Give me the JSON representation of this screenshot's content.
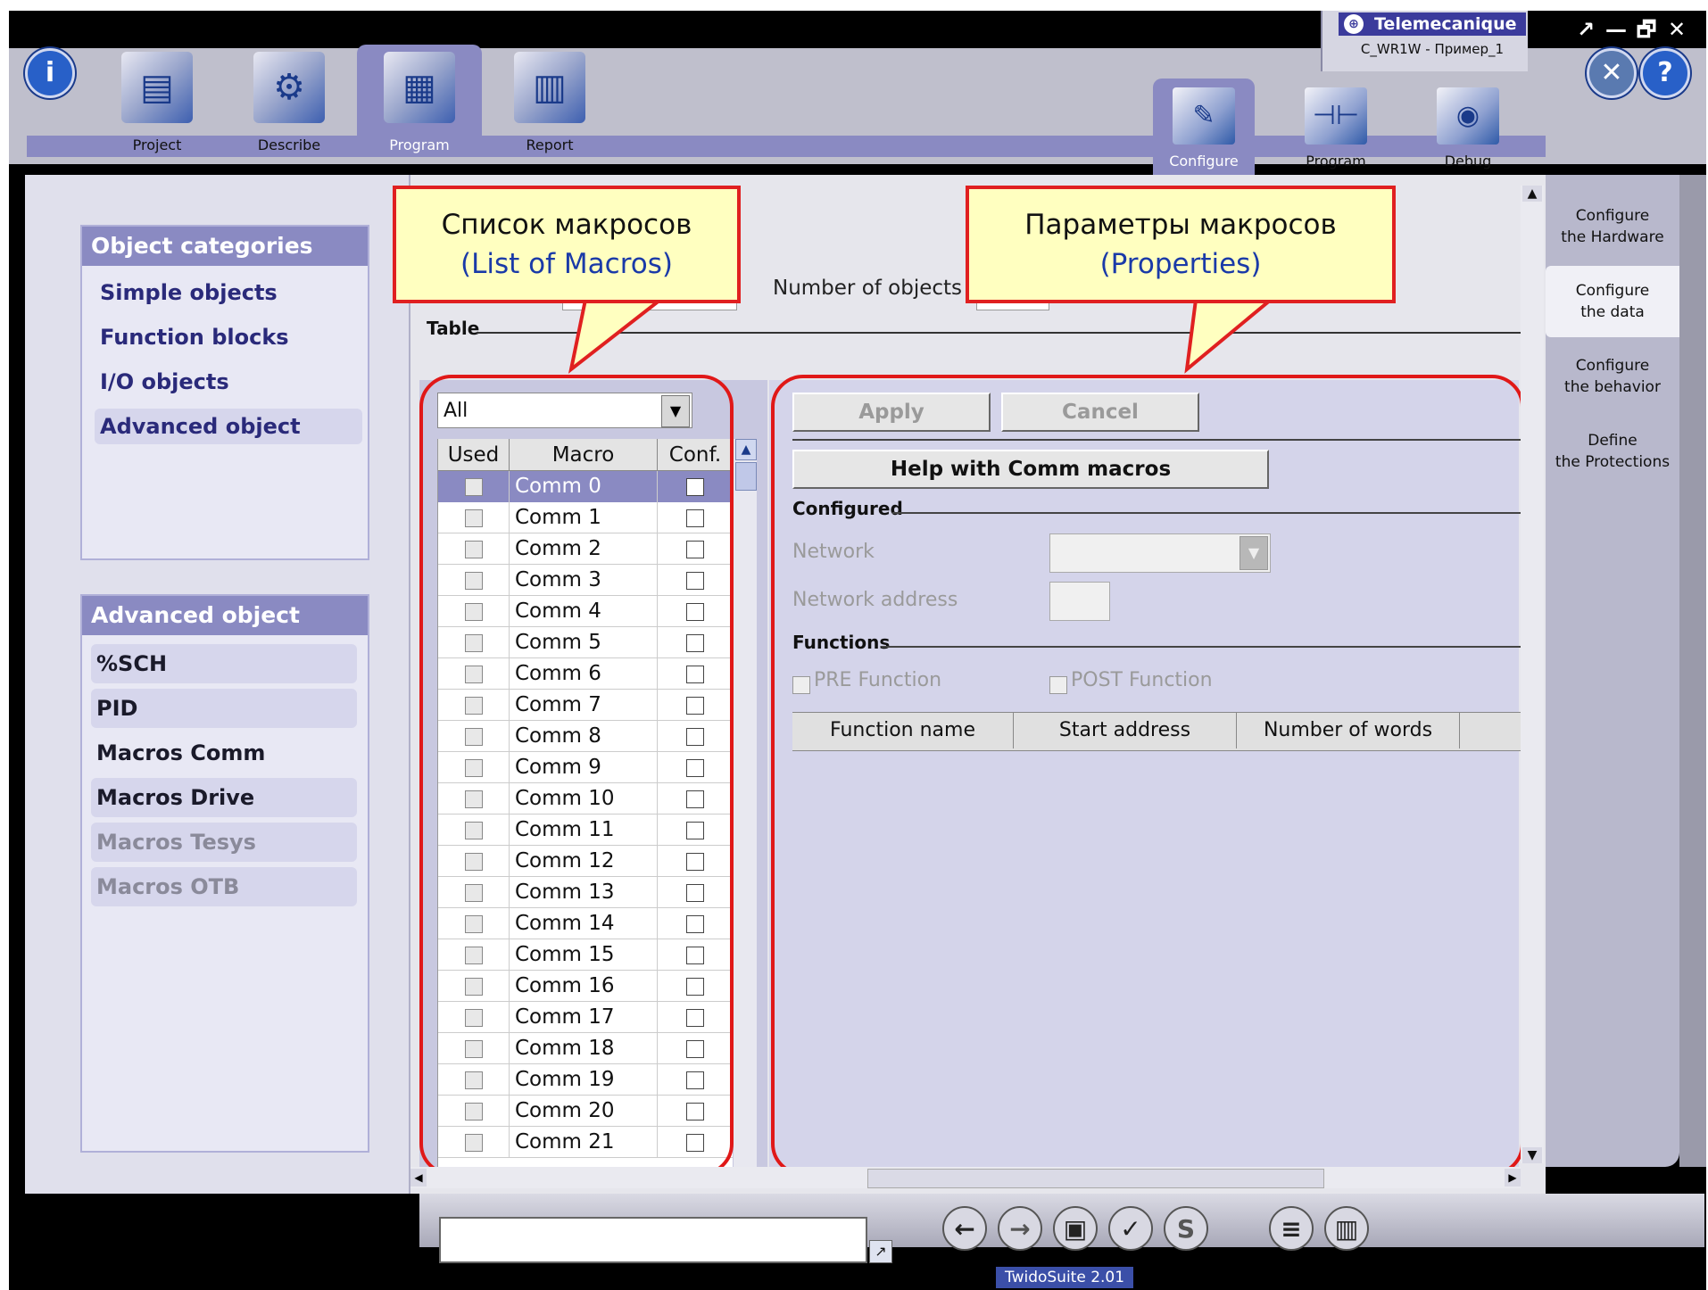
{
  "brand": {
    "name": "Telemecanique",
    "project": "C_WR1W - Пример_1"
  },
  "window_controls": [
    "↗",
    "—",
    "🗗",
    "✕"
  ],
  "top_tabs": [
    {
      "label": "Project",
      "icon": "project-folder-icon",
      "active": false
    },
    {
      "label": "Describe",
      "icon": "describe-folder-icon",
      "active": false
    },
    {
      "label": "Program",
      "icon": "program-folder-icon",
      "active": true
    },
    {
      "label": "Report",
      "icon": "report-folder-icon",
      "active": false
    }
  ],
  "sub_tabs": [
    {
      "label": "Configure",
      "icon": "configure-icon",
      "active": true
    },
    {
      "label": "Program",
      "icon": "program-ladder-icon",
      "active": false
    },
    {
      "label": "Debug",
      "icon": "debug-eye-icon",
      "active": false
    }
  ],
  "left": {
    "categories_title": "Object categories",
    "categories": [
      "Simple objects",
      "Function blocks",
      "I/O objects",
      "Advanced object"
    ],
    "selected_category": "Advanced object",
    "advanced_title": "Advanced object",
    "advanced_items": [
      {
        "label": "%SCH",
        "enabled": true
      },
      {
        "label": "PID",
        "enabled": true
      },
      {
        "label": "Macros Comm",
        "enabled": true
      },
      {
        "label": "Macros Drive",
        "enabled": true
      },
      {
        "label": "Macros Tesys",
        "enabled": false
      },
      {
        "label": "Macros OTB",
        "enabled": false
      }
    ]
  },
  "content": {
    "number_of_objects_label": "Number of objects",
    "table_label": "Table",
    "filter_value": "All",
    "columns": [
      "Used",
      "Macro",
      "Conf."
    ],
    "macros": [
      "Comm 0",
      "Comm 1",
      "Comm 2",
      "Comm 3",
      "Comm 4",
      "Comm 5",
      "Comm 6",
      "Comm 7",
      "Comm 8",
      "Comm 9",
      "Comm 10",
      "Comm 11",
      "Comm 12",
      "Comm 13",
      "Comm 14",
      "Comm 15",
      "Comm 16",
      "Comm 17",
      "Comm 18",
      "Comm 19",
      "Comm 20",
      "Comm 21"
    ],
    "selected_macro": "Comm 0"
  },
  "props": {
    "apply": "Apply",
    "cancel": "Cancel",
    "help": "Help with Comm macros",
    "configured": "Configured",
    "network": "Network",
    "network_address": "Network address",
    "functions": "Functions",
    "pre_function": "PRE Function",
    "post_function": "POST Function",
    "func_columns": [
      "Function name",
      "Start address",
      "Number of words"
    ]
  },
  "callouts": {
    "list": {
      "ru": "Список макросов",
      "en": "(List of Macros)"
    },
    "props": {
      "ru": "Параметры макросов",
      "en": "(Properties)"
    }
  },
  "right_nav": [
    {
      "line1": "Configure",
      "line2": "the Hardware",
      "active": false
    },
    {
      "line1": "Configure",
      "line2": "the data",
      "active": true
    },
    {
      "line1": "Configure",
      "line2": "the behavior",
      "active": false
    },
    {
      "line1": "Define",
      "line2": "the Protections",
      "active": false
    }
  ],
  "footer": {
    "suite": "TwidoSuite 2.01"
  },
  "colors": {
    "accent": "#8a8ac2",
    "callout_border": "#e02020",
    "callout_fill": "#ffffc0",
    "brand": "#3b3b9c"
  }
}
